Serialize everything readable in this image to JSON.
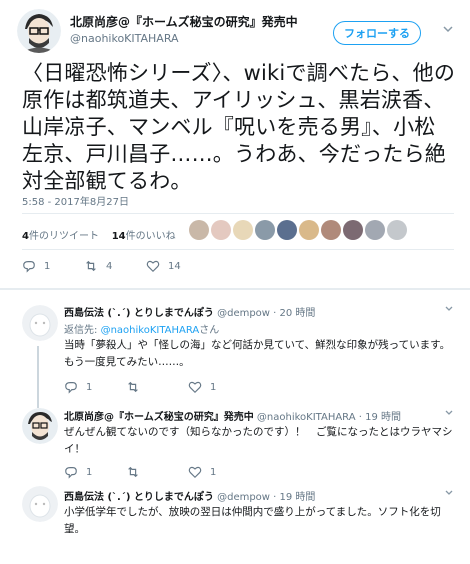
{
  "main_tweet": {
    "author_name": "北原尚彦@『ホームズ秘宝の研究』発売中",
    "author_handle": "@naohikoKITAHARA",
    "follow_label": "フォローする",
    "text": "〈日曜恐怖シリーズ〉、wikiで調べたら、他の原作は都筑道夫、アイリッシュ、黒岩涙香、山岸凉子、マンベル『呪いを売る男』、小松左京、戸川昌子……。うわあ、今だったら絶対全部観てるわ。",
    "timestamp": "5:58 - 2017年8月27日",
    "retweets_count": "4",
    "retweets_label": "件のリツイート",
    "likes_count": "14",
    "likes_label": "件のいいね",
    "actions": {
      "reply": "1",
      "retweet": "4",
      "like": "14"
    },
    "liker_colors": [
      "#c9b8a8",
      "#e4c9c0",
      "#e8d8b8",
      "#8a9aa8",
      "#5b6f8f",
      "#d9b98a",
      "#b08a7a",
      "#7c6a72",
      "#a2a8b2",
      "#c4c8cc"
    ]
  },
  "replies": [
    {
      "name": "西島伝法 (`.´) とりしまでんぽう",
      "handle": "@dempow",
      "time": "20 時間",
      "reply_to_prefix": "返信先: ",
      "reply_to_mention": "@naohikoKITAHARA",
      "reply_to_suffix": "さん",
      "text": "当時「夢殺人」や「怪しの海」など何話か見ていて、鮮烈な印象が残っています。もう一度見てみたい……。",
      "reply_count": "1",
      "retweet_count": "",
      "like_count": "1"
    },
    {
      "name": "北原尚彦@『ホームズ秘宝の研究』発売中",
      "handle": "@naohikoKITAHARA",
      "time": "19 時間",
      "text": "ぜんぜん観てないのです（知らなかったのです）！　ご覧になったとはウラヤマシイ！",
      "reply_count": "1",
      "retweet_count": "",
      "like_count": "1"
    },
    {
      "name": "西島伝法 (`.´) とりしまでんぽう",
      "handle": "@dempow",
      "time": "19 時間",
      "text": "小学低学年でしたが、放映の翌日は仲間内で盛り上がってました。ソフト化を切望。"
    }
  ],
  "colors": {
    "accent": "#1da1f2",
    "muted": "#657786",
    "border": "#e6ecf0"
  },
  "icons": [
    "reply-icon",
    "retweet-icon",
    "like-icon",
    "chevron-down-icon"
  ]
}
